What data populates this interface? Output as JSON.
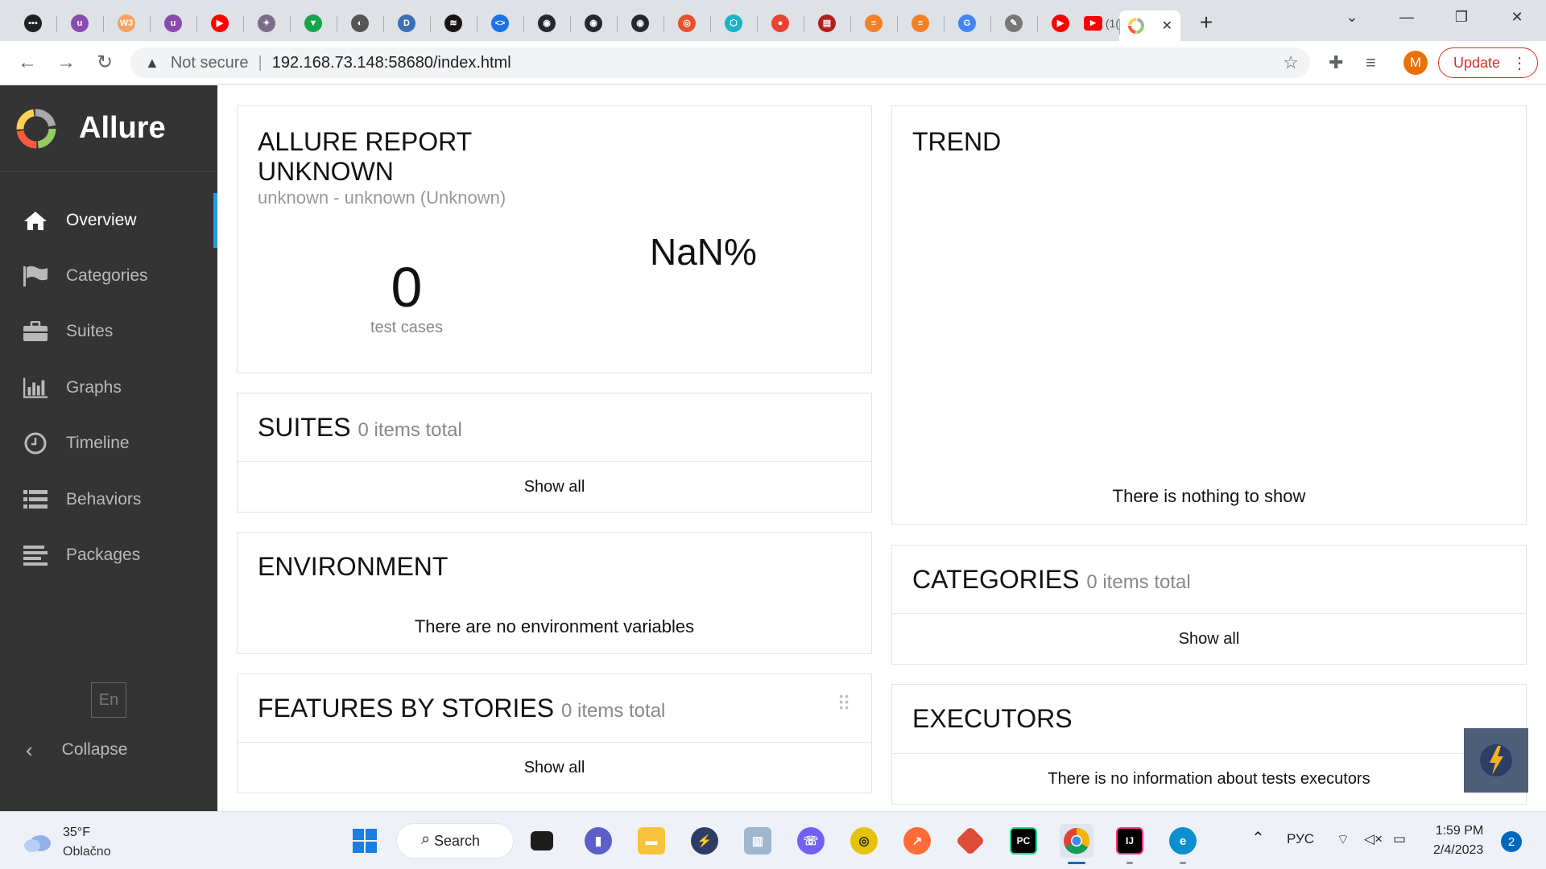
{
  "browser": {
    "tabs": [
      {
        "icon": "dots-favicon",
        "color": "#202124",
        "glyph": "▪▪▪"
      },
      {
        "icon": "purple-u-favicon",
        "color": "#8a4baf",
        "glyph": "u"
      },
      {
        "icon": "w3schools-favicon",
        "color": "#f5a25d",
        "glyph": "W3"
      },
      {
        "icon": "purple-u-favicon",
        "color": "#8a4baf",
        "glyph": "u"
      },
      {
        "icon": "youtube-favicon",
        "color": "#ff0000",
        "glyph": "▶"
      },
      {
        "icon": "bookmark-favicon",
        "color": "#7d6b8c",
        "glyph": "✦"
      },
      {
        "icon": "shield-favicon",
        "color": "#16a34a",
        "glyph": "▼"
      },
      {
        "icon": "globe-favicon",
        "color": "#555555",
        "glyph": "◐"
      },
      {
        "icon": "d-favicon",
        "color": "#3b6fb6",
        "glyph": "D"
      },
      {
        "icon": "spotify-favicon",
        "color": "#191414",
        "glyph": "≋"
      },
      {
        "icon": "code-favicon",
        "color": "#1a73e8",
        "glyph": "<>"
      },
      {
        "icon": "github-favicon",
        "color": "#24292f",
        "glyph": "◉"
      },
      {
        "icon": "github-favicon",
        "color": "#24292f",
        "glyph": "◉"
      },
      {
        "icon": "github-favicon",
        "color": "#24292f",
        "glyph": "◉"
      },
      {
        "icon": "circle-favicon",
        "color": "#e5522c",
        "glyph": "◎"
      },
      {
        "icon": "hex-favicon",
        "color": "#1ab4c8",
        "glyph": "⬡"
      },
      {
        "icon": "pin-favicon",
        "color": "#ea4335",
        "glyph": "●"
      },
      {
        "icon": "book-favicon",
        "color": "#b21f1f",
        "glyph": "▤"
      },
      {
        "icon": "stackoverflow-favicon",
        "color": "#f48024",
        "glyph": "≡"
      },
      {
        "icon": "stackoverflow-favicon",
        "color": "#f48024",
        "glyph": "≡"
      },
      {
        "icon": "google-favicon",
        "color": "#4285f4",
        "glyph": "G"
      },
      {
        "icon": "puzzle-favicon",
        "color": "#777777",
        "glyph": "✎"
      },
      {
        "icon": "youtube-favicon",
        "color": "#ff0000",
        "glyph": "▶"
      }
    ],
    "partial_tab_label": "(1(",
    "active_tab_close": "✕",
    "new_tab": "+",
    "window_controls": {
      "dropdown": "⌄",
      "minimize": "—",
      "restore": "❐",
      "close": "✕"
    },
    "omnibox": {
      "security_label": "Not secure",
      "url": "192.168.73.148:58680/index.html"
    },
    "profile_initial": "M",
    "update_label": "Update"
  },
  "sidebar": {
    "brand": "Allure",
    "nav": [
      {
        "label": "Overview",
        "icon": "home-icon",
        "active": true
      },
      {
        "label": "Categories",
        "icon": "flag-icon",
        "active": false
      },
      {
        "label": "Suites",
        "icon": "briefcase-icon",
        "active": false
      },
      {
        "label": "Graphs",
        "icon": "bar-chart-icon",
        "active": false
      },
      {
        "label": "Timeline",
        "icon": "clock-icon",
        "active": false
      },
      {
        "label": "Behaviors",
        "icon": "list-icon",
        "active": false
      },
      {
        "label": "Packages",
        "icon": "align-left-icon",
        "active": false
      }
    ],
    "language": "En",
    "collapse_label": "Collapse"
  },
  "summary": {
    "title_line1": "ALLURE REPORT",
    "title_line2": "UNKNOWN",
    "subtitle": "unknown - unknown (Unknown)",
    "test_count": "0",
    "test_count_label": "test cases",
    "percent": "NaN%"
  },
  "suites": {
    "title": "SUITES",
    "count_label": "0 items total",
    "show_all": "Show all"
  },
  "environment": {
    "title": "ENVIRONMENT",
    "message": "There are no environment variables"
  },
  "features": {
    "title": "FEATURES BY STORIES",
    "count_label": "0 items total",
    "show_all": "Show all"
  },
  "trend": {
    "title": "TREND",
    "message": "There is nothing to show"
  },
  "categories": {
    "title": "CATEGORIES",
    "count_label": "0 items total",
    "show_all": "Show all"
  },
  "executors": {
    "title": "EXECUTORS",
    "message": "There is no information about tests executors"
  },
  "taskbar": {
    "weather_temp": "35°F",
    "weather_desc": "Oblačno",
    "search_label": "Search",
    "language": "РУС",
    "time": "1:59 PM",
    "date": "2/4/2023",
    "notification_count": "2"
  }
}
